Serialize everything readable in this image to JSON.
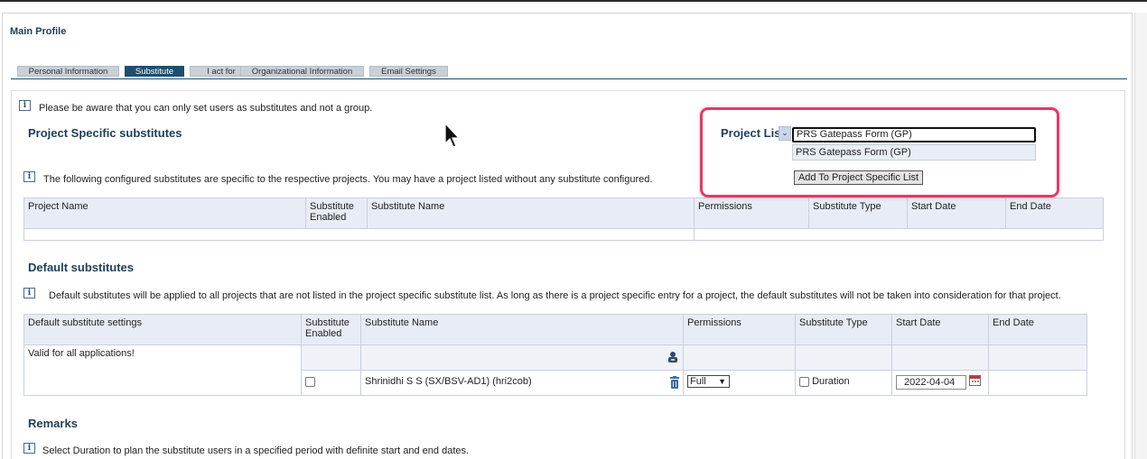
{
  "page": {
    "title": "Main Profile"
  },
  "tabs": [
    {
      "label": "Personal Information"
    },
    {
      "label": "Substitute"
    },
    {
      "label": "I act for"
    },
    {
      "label": "Organizational Information"
    },
    {
      "label": "Email Settings"
    }
  ],
  "notice": {
    "text": "Please be aware that you can only set users as substitutes and not a group."
  },
  "project_specific": {
    "title": "Project Specific substitutes",
    "info": "The following configured substitutes are specific to the respective projects. You may have a project listed without any substitute configured.",
    "columns": [
      "Project Name",
      "Substitute Enabled",
      "Substitute Name",
      "Permissions",
      "Substitute Type",
      "Start Date",
      "End Date"
    ]
  },
  "project_list": {
    "label": "Project Lis",
    "input_value": "PRS Gatepass Form (GP)",
    "option": "PRS Gatepass Form (GP)",
    "add_button": "Add To Project Specific List"
  },
  "default_substitutes": {
    "title": "Default substitutes",
    "info": "Default substitutes will be applied to all projects that are not listed in the project specific substitute list. As long as there is a project specific entry for a project, the default substitutes will not be taken into consideration for that project.",
    "columns": [
      "Default substitute settings",
      "Substitute Enabled",
      "Substitute Name",
      "Permissions",
      "Substitute Type",
      "Start Date",
      "End Date"
    ],
    "valid_text": "Valid for all applications!",
    "row": {
      "name": "Shrinidhi S S (SX/BSV-AD1) (hri2cob)",
      "permission": "Full",
      "type": "Duration",
      "start_date": "2022-04-04",
      "enabled": false
    }
  },
  "remarks": {
    "title": "Remarks",
    "info": "Select Duration to plan the substitute users in a specified period with definite start and end dates."
  },
  "colors": {
    "accent": "#1f4e6e",
    "title": "#1d3e5a",
    "highlight": "#e23a6a",
    "header_bg": "#e8ecf6"
  }
}
